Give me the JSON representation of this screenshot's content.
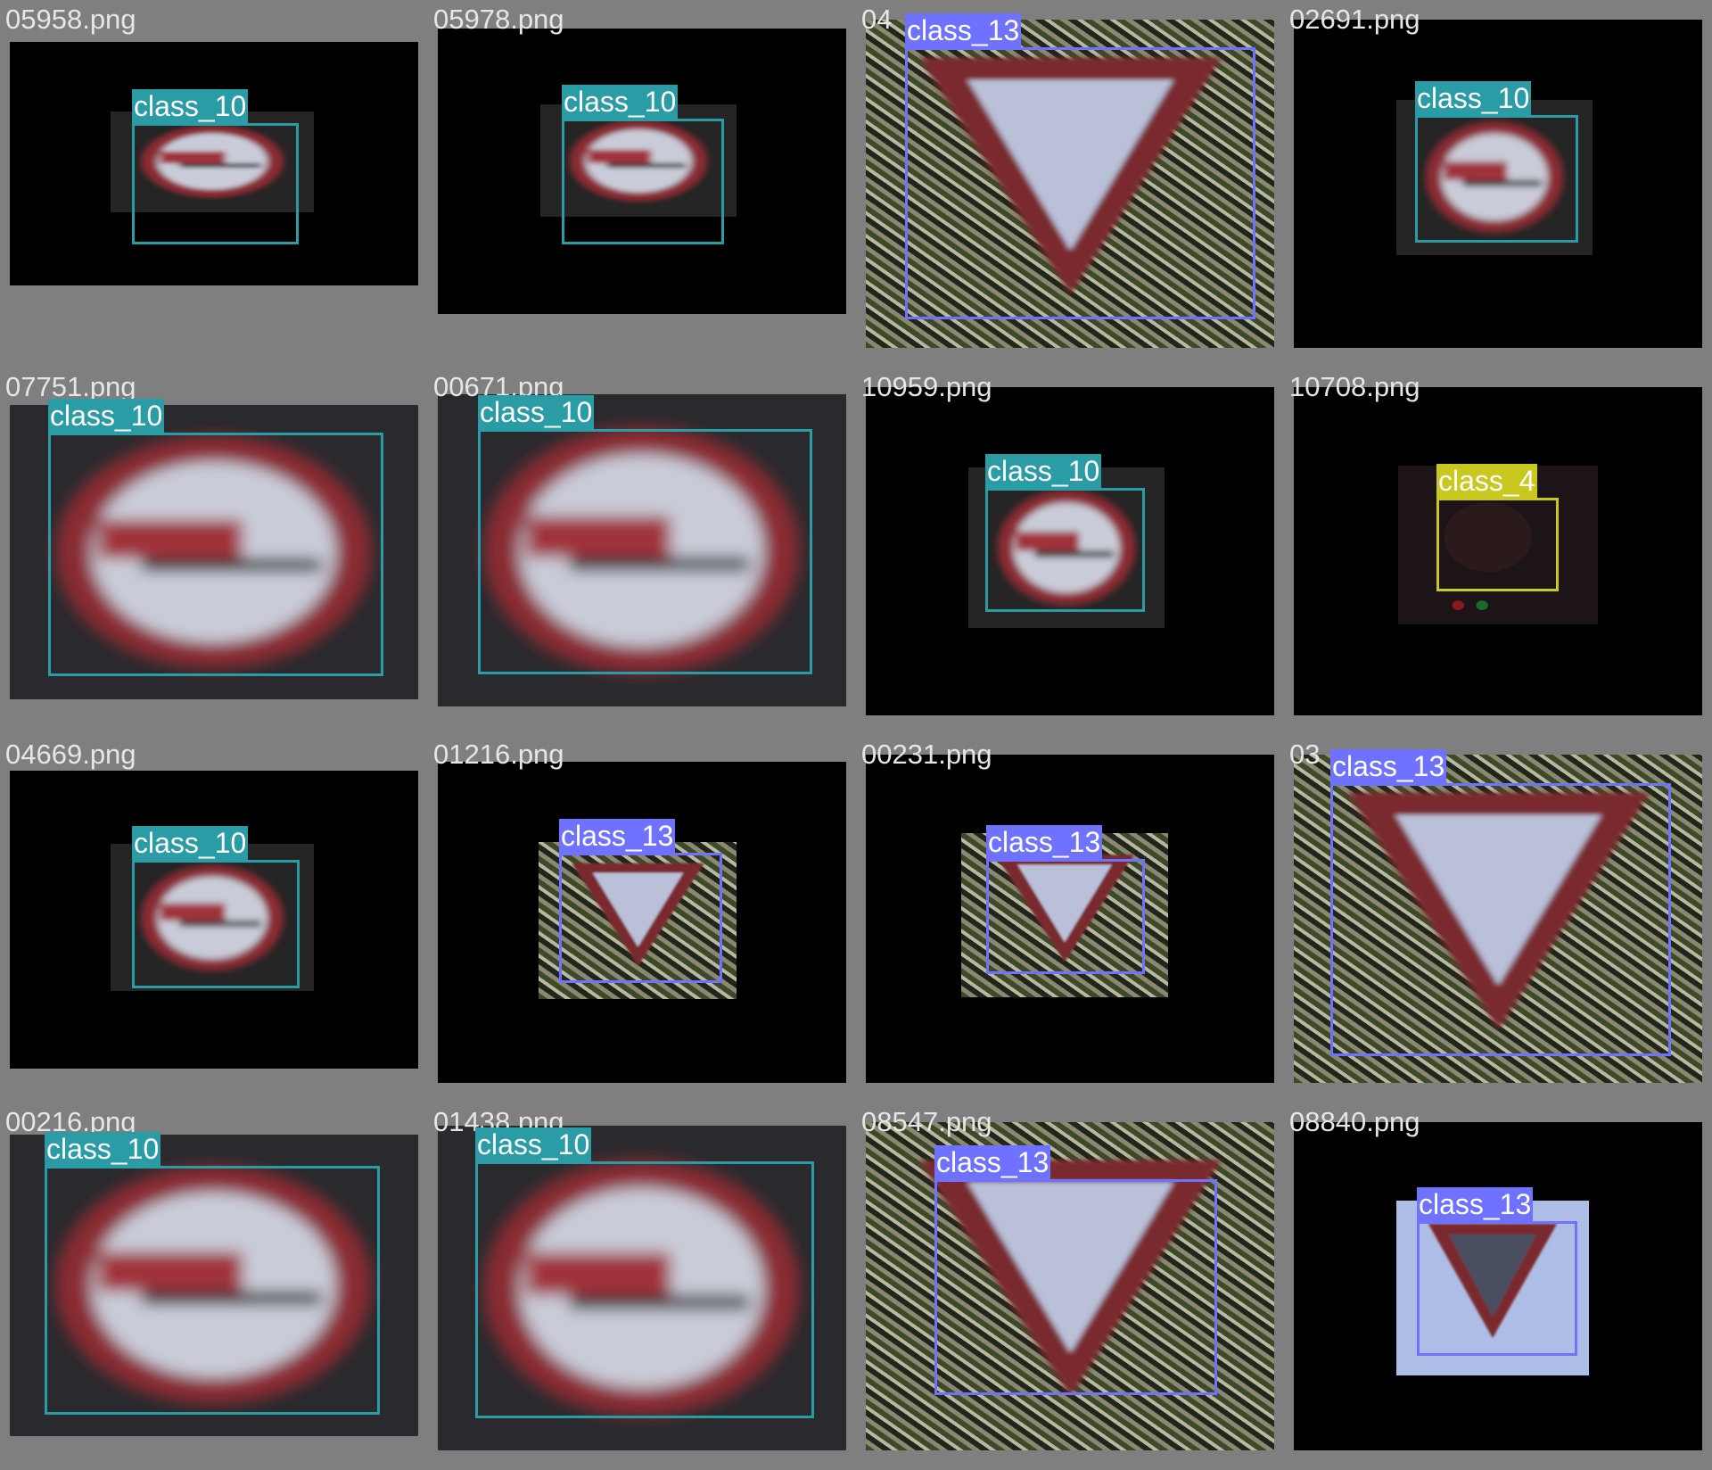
{
  "colors": {
    "class_10": "#2a9ca6",
    "class_13": "#6f72ff",
    "class_4": "#c8c81e"
  },
  "cells": [
    {
      "filename": "05958.png",
      "label": "class_10"
    },
    {
      "filename": "05978.png",
      "label": "class_10"
    },
    {
      "filename": "04",
      "label": "class_13"
    },
    {
      "filename": "02691.png",
      "label": "class_10"
    },
    {
      "filename": "07751.png",
      "label": "class_10"
    },
    {
      "filename": "00671.png",
      "label": "class_10"
    },
    {
      "filename": "10959.png",
      "label": "class_10"
    },
    {
      "filename": "10708.png",
      "label": "class_4"
    },
    {
      "filename": "04669.png",
      "label": "class_10"
    },
    {
      "filename": "01216.png",
      "label": "class_13"
    },
    {
      "filename": "00231.png",
      "label": "class_13"
    },
    {
      "filename": "03",
      "label": "class_13"
    },
    {
      "filename": "00216.png",
      "label": "class_10"
    },
    {
      "filename": "01438.png",
      "label": "class_10"
    },
    {
      "filename": "08547.png",
      "label": "class_13"
    },
    {
      "filename": "08840.png",
      "label": "class_13"
    }
  ]
}
